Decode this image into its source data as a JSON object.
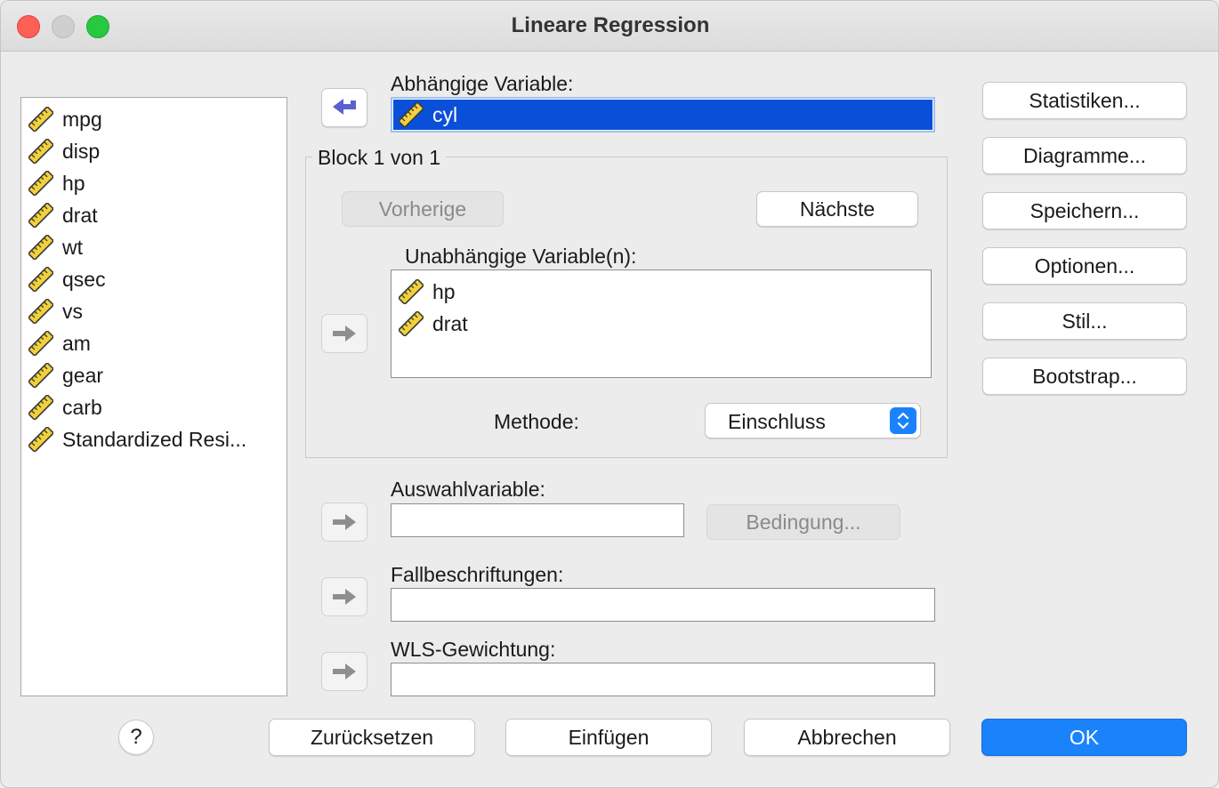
{
  "window": {
    "title": "Lineare Regression"
  },
  "source_variables": [
    "mpg",
    "disp",
    "hp",
    "drat",
    "wt",
    "qsec",
    "vs",
    "am",
    "gear",
    "carb",
    "Standardized Resi..."
  ],
  "dependent": {
    "label": "Abhängige Variable:",
    "value": "cyl"
  },
  "block": {
    "title": "Block 1 von 1",
    "previous_label": "Vorherige",
    "next_label": "Nächste",
    "independent_label": "Unabhängige Variable(n):",
    "independent_values": [
      "hp",
      "drat"
    ],
    "method_label": "Methode:",
    "method_value": "Einschluss"
  },
  "selection": {
    "label": "Auswahlvariable:",
    "value": "",
    "condition_label": "Bedingung..."
  },
  "case_labels": {
    "label": "Fallbeschriftungen:",
    "value": ""
  },
  "wls": {
    "label": "WLS-Gewichtung:",
    "value": ""
  },
  "side_buttons": [
    "Statistiken...",
    "Diagramme...",
    "Speichern...",
    "Optionen...",
    "Stil...",
    "Bootstrap..."
  ],
  "footer": {
    "help": "?",
    "reset": "Zurücksetzen",
    "paste": "Einfügen",
    "cancel": "Abbrechen",
    "ok": "OK"
  },
  "colors": {
    "selection": "#0a4fd8",
    "accent": "#1a82fb",
    "arrow_active": "#5b5fd0",
    "arrow_disabled": "#8e8e8e"
  },
  "icons": {
    "variable": "ruler-icon",
    "move_active": "arrow-left-icon",
    "move_disabled": "arrow-right-icon",
    "select": "chevron-updown-icon"
  }
}
